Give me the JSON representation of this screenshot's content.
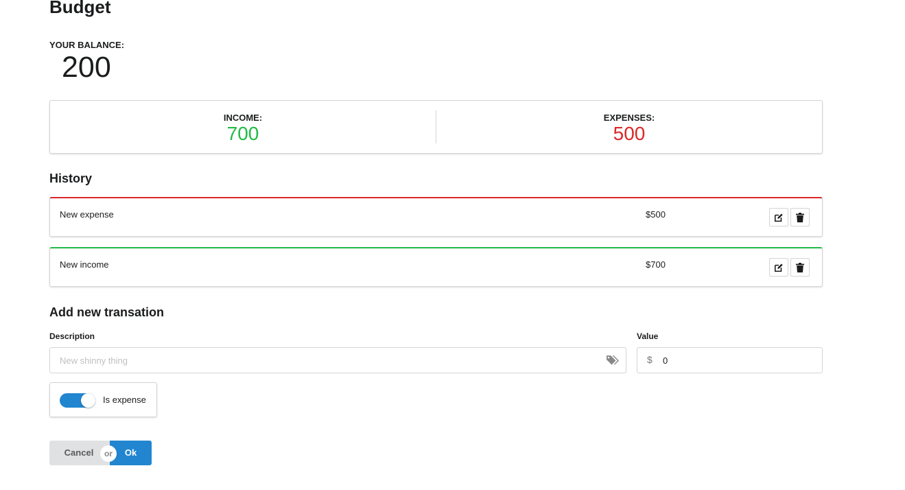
{
  "header": {
    "title": "Budget"
  },
  "balance": {
    "label": "YOUR BALANCE:",
    "value": "200"
  },
  "stats": {
    "income": {
      "label": "INCOME:",
      "value": "700"
    },
    "expenses": {
      "label": "EXPENSES:",
      "value": "500"
    }
  },
  "history": {
    "heading": "History",
    "items": [
      {
        "description": "New expense",
        "amount": "$500",
        "type": "expense"
      },
      {
        "description": "New income",
        "amount": "$700",
        "type": "income"
      }
    ]
  },
  "form": {
    "heading": "Add new transation",
    "description_label": "Description",
    "description_placeholder": "New shinny thing",
    "value_label": "Value",
    "value": "0",
    "currency_symbol": "$",
    "is_expense_label": "Is expense",
    "is_expense": true,
    "cancel_label": "Cancel",
    "or_label": "or",
    "ok_label": "Ok"
  },
  "colors": {
    "income": "#21ba45",
    "expense": "#db2828",
    "primary": "#2185d0"
  },
  "icons": {
    "edit": "edit-icon",
    "delete": "trash-icon",
    "tag": "tags-icon"
  }
}
